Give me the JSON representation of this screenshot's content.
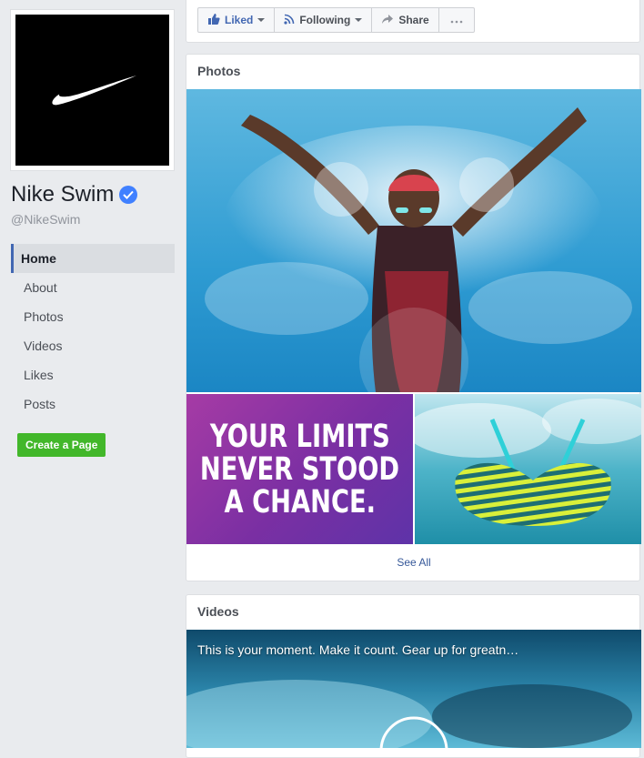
{
  "sidebar": {
    "page_name": "Nike Swim",
    "handle": "@NikeSwim",
    "nav": [
      "Home",
      "About",
      "Photos",
      "Videos",
      "Likes",
      "Posts"
    ],
    "create_page": "Create a Page"
  },
  "actions": {
    "liked": "Liked",
    "following": "Following",
    "share": "Share"
  },
  "photos": {
    "title": "Photos",
    "poster_lines": [
      "YOUR LIMITS",
      "NEVER STOOD",
      "A CHANCE."
    ],
    "see_all": "See All"
  },
  "videos": {
    "title": "Videos",
    "caption": "This is your moment. Make it count. Gear up for greatn…"
  },
  "colors": {
    "accent": "#4267b2",
    "verified": "#4080ff",
    "create_button": "#42b72a",
    "link": "#365899"
  }
}
